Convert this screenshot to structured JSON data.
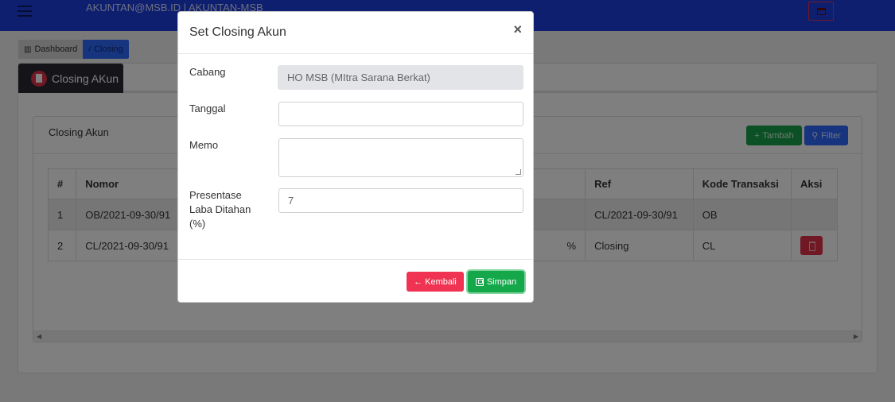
{
  "header": {
    "user_text": "AKUNTAN@MSB.ID | AKUNTAN-MSB"
  },
  "breadcrumb": {
    "items": [
      {
        "label": "Dashboard",
        "icon": "bar-chart-icon"
      },
      {
        "label": "Closing",
        "icon": "pencil-icon"
      }
    ]
  },
  "tab": {
    "label": "Closing AKun",
    "icon": "file-icon"
  },
  "panel": {
    "title": "Closing Akun",
    "add_label": "Tambah",
    "filter_label": "Filter"
  },
  "table": {
    "columns": [
      "#",
      "Nomor",
      "",
      "",
      "",
      "Ref",
      "Kode Transaksi",
      "Aksi"
    ],
    "rows": [
      {
        "no": "1",
        "nomor": "OB/2021-09-30/91",
        "c3": "",
        "c4": "",
        "c5": "",
        "ref": "CL/2021-09-30/91",
        "kode": "OB"
      },
      {
        "no": "2",
        "nomor": "CL/2021-09-30/91",
        "c3": "",
        "c4": "",
        "c5": "%",
        "ref": "Closing",
        "kode": "CL"
      }
    ]
  },
  "modal": {
    "title": "Set Closing Akun",
    "close_symbol": "×",
    "cabang_label": "Cabang",
    "cabang_value": "HO MSB (MItra Sarana Berkat)",
    "tanggal_label": "Tanggal",
    "tanggal_value": "",
    "memo_label": "Memo",
    "memo_value": "",
    "presentase_label_1": "Presentase",
    "presentase_label_2": "Laba Ditahan",
    "presentase_label_3": "(%)",
    "presentase_value": "7",
    "back_label": "Kembali",
    "back_arrow": "←",
    "save_label": "Simpan"
  },
  "colors": {
    "topbar": "#1f3fe0",
    "primary": "#2f6bff",
    "success": "#14a84a",
    "danger": "#f03352"
  }
}
